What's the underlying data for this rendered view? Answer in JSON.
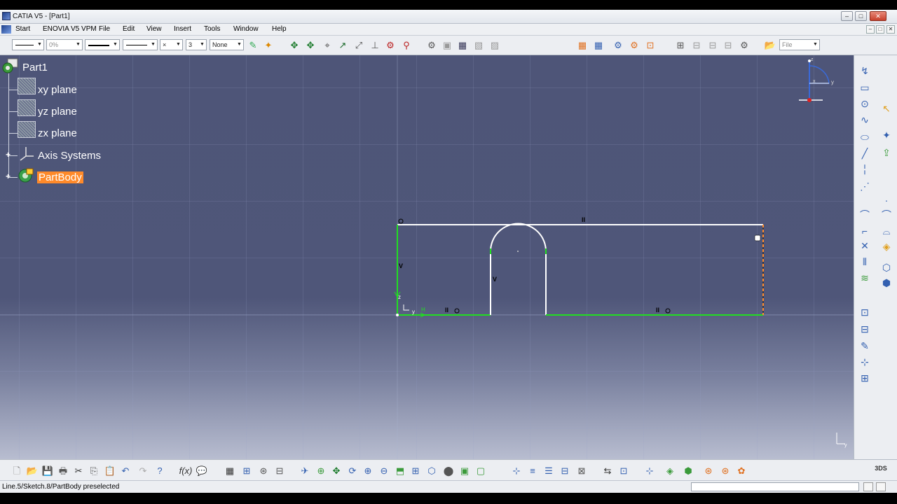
{
  "window": {
    "title": "CATIA V5 - [Part1]",
    "minimize": "–",
    "maximize": "□",
    "close": "✕"
  },
  "menu": {
    "items": [
      "Start",
      "ENOVIA V5 VPM",
      "File",
      "Edit",
      "View",
      "Insert",
      "Tools",
      "Window",
      "Help"
    ],
    "doc_controls": [
      "–",
      "□",
      "✕"
    ]
  },
  "toolbar": {
    "color_combo": "",
    "transparency_combo": "0%",
    "linewidth_combo": "",
    "linetype_combo": "",
    "point_combo": "×",
    "layer_num_combo": "3",
    "layer_combo": "None",
    "file_combo": "File"
  },
  "tree": {
    "root": "Part1",
    "items": [
      {
        "label": "xy plane",
        "icon": "plane-icon"
      },
      {
        "label": "yz plane",
        "icon": "plane-icon"
      },
      {
        "label": "zx plane",
        "icon": "plane-icon"
      },
      {
        "label": "Axis Systems",
        "icon": "axis-system-icon"
      },
      {
        "label": "PartBody",
        "icon": "partbody-icon",
        "selected": true
      }
    ]
  },
  "sketch": {
    "constraint_labels": {
      "horizontal": "H",
      "vertical": "V",
      "horizontal_symbol": "II",
      "origin_h": "H",
      "origin_v": "V"
    },
    "colors": {
      "profile": "#ffffff",
      "constrained": "#22dd22",
      "preselect": "#ff8a2a"
    }
  },
  "compass": {
    "x_label": "x",
    "y_label": "y",
    "z_label": "z"
  },
  "status": {
    "message": "Line.5/Sketch.8/PartBody preselected"
  },
  "colors": {
    "viewport_bg": "#4e5578",
    "selection": "#ff8a2a",
    "toolbar_bg": "#eceef2"
  }
}
